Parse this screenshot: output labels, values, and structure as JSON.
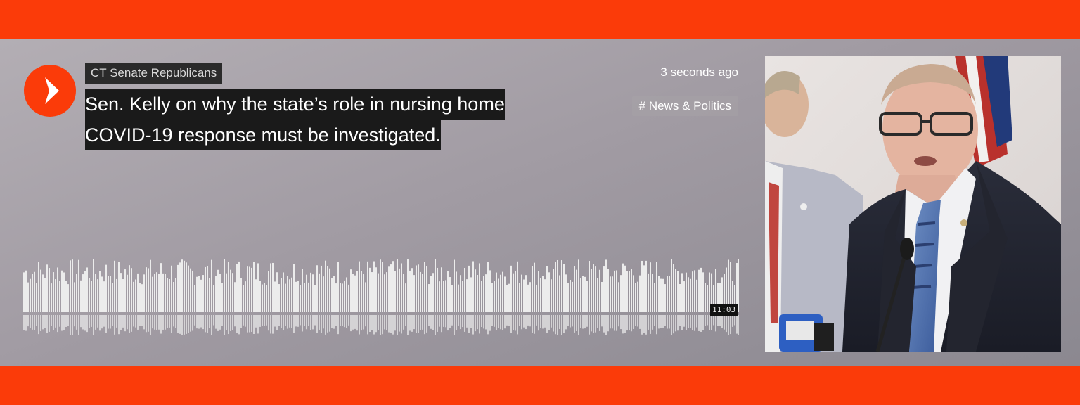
{
  "track": {
    "author": "CT Senate Republicans",
    "title_line1": " Sen. Kelly on why the state’s role in nursing home",
    "title_line2": "COVID-19 response must be investigated.",
    "time_ago": "3 seconds ago",
    "genre": "# News & Politics",
    "duration": "11:03",
    "playback_progress": 0
  },
  "colors": {
    "accent": "#fb3b09",
    "waveform": "#ececec"
  },
  "icons": {
    "play": "play-icon"
  }
}
